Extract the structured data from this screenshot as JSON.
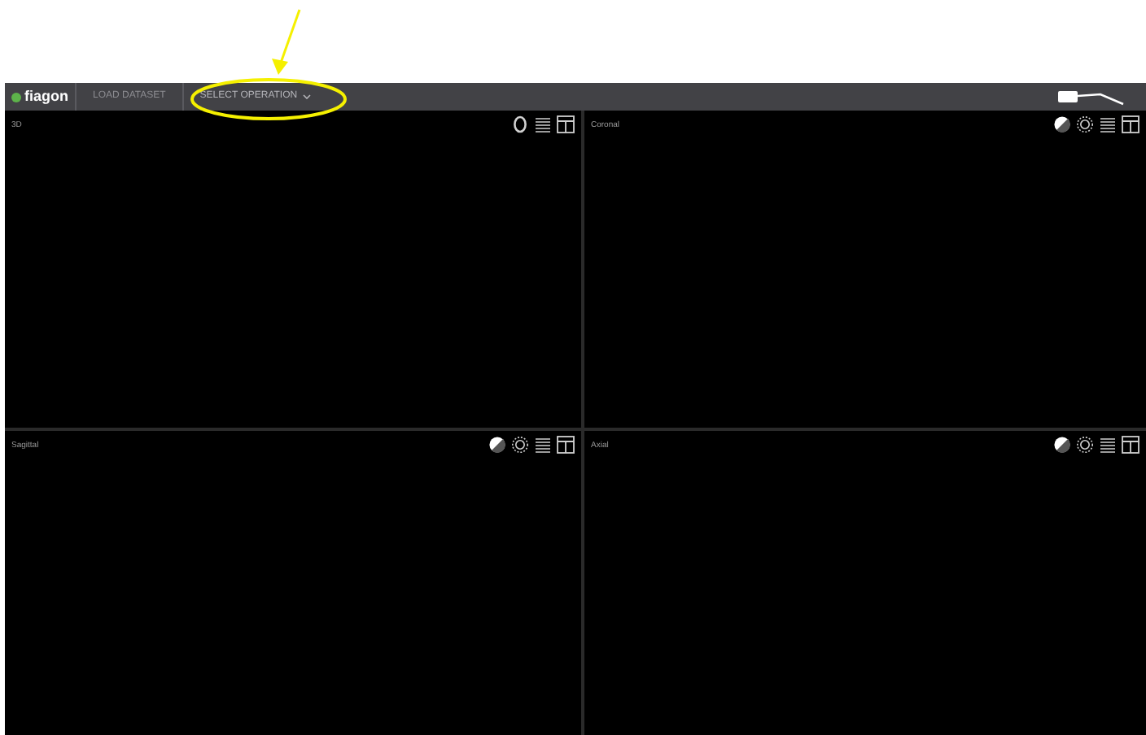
{
  "app_bar": {
    "logo": "fiagon",
    "breadcrumbs": [
      {
        "label": "LOAD DATASET",
        "selected": false,
        "dropdown": false
      },
      {
        "label": "SELECT OPERATION",
        "selected": true,
        "dropdown": true
      }
    ]
  },
  "views": [
    {
      "label": "3D",
      "tools": [
        {
          "kind": "head"
        },
        {
          "kind": "list"
        },
        {
          "kind": "layout"
        }
      ]
    },
    {
      "label": "Coronal",
      "tools": [
        {
          "kind": "contrast"
        },
        {
          "kind": "brightness"
        },
        {
          "kind": "list"
        },
        {
          "kind": "layout"
        }
      ]
    },
    {
      "label": "Sagittal",
      "tools": [
        {
          "kind": "contrast"
        },
        {
          "kind": "brightness"
        },
        {
          "kind": "list"
        },
        {
          "kind": "layout"
        }
      ]
    },
    {
      "label": "Axial",
      "tools": [
        {
          "kind": "contrast"
        },
        {
          "kind": "brightness"
        },
        {
          "kind": "list"
        },
        {
          "kind": "layout"
        }
      ]
    }
  ]
}
